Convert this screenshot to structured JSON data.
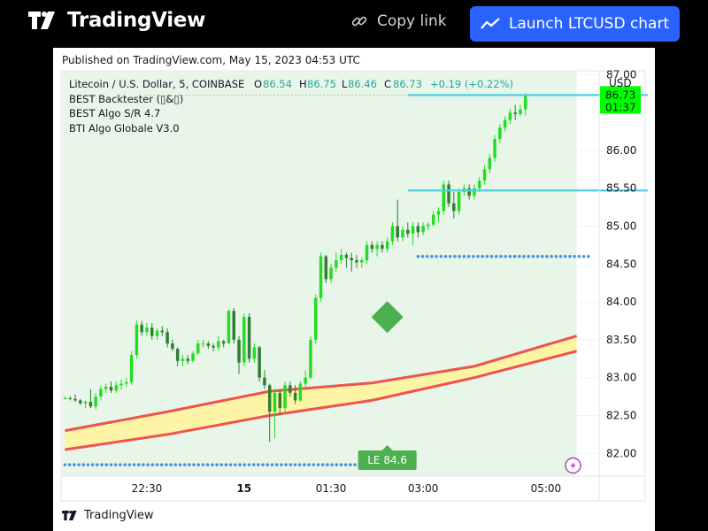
{
  "header": {
    "logo_text": "TradingView",
    "copy_link_label": "Copy link",
    "launch_label": "Launch LTCUSD chart",
    "icons": {
      "logo": "tradingview-logo-icon",
      "copy": "link-icon",
      "launch": "chart-line-icon"
    }
  },
  "published": "Published on TradingView.com, May 15, 2023 04:53 UTC",
  "legend": {
    "symbol": "Litecoin / U.S. Dollar, 5, COINBASE",
    "o_label": "O",
    "o_value": "86.54",
    "h_label": "H",
    "h_value": "86.75",
    "l_label": "L",
    "l_value": "86.46",
    "c_label": "C",
    "c_value": "86.73",
    "change": "+0.19 (+0.22%)",
    "indicators": [
      "BEST Backtester (▯&▯)",
      "BEST Algo S/R 4.7",
      "BTI Algo Globale V3.0"
    ]
  },
  "footer_logo_text": "TradingView",
  "chart_data": {
    "type": "candlestick",
    "symbol": "LTCUSD",
    "exchange": "COINBASE",
    "interval": "5",
    "currency_label": "USD",
    "ylim": [
      81.7,
      87.05
    ],
    "y_ticks": [
      "87.00",
      "86.00",
      "85.50",
      "85.00",
      "84.50",
      "84.00",
      "83.50",
      "83.00",
      "82.50",
      "82.00"
    ],
    "x_ticks": [
      {
        "label": "22:30",
        "bold": false,
        "index": 16
      },
      {
        "label": "15",
        "bold": true,
        "index": 35
      },
      {
        "label": "01:30",
        "bold": false,
        "index": 52
      },
      {
        "label": "03:00",
        "bold": false,
        "index": 70
      },
      {
        "label": "05:00",
        "bold": false,
        "index": 94
      }
    ],
    "last_price": "86.73",
    "countdown": "01:37",
    "bar_count_capacity": 104,
    "colors": {
      "up": "#22dd22",
      "down": "#2e7d32",
      "support": "#4dd0e1",
      "band": "#ef5350",
      "band_fill": "#fff59d",
      "dots": "#4a90d9",
      "bg_zone": "#e8f5e9",
      "signal": "#4caf50",
      "price_tag": "#00ff00"
    },
    "candles": [
      [
        82.73,
        82.75,
        82.71,
        82.73
      ],
      [
        82.73,
        82.75,
        82.7,
        82.72
      ],
      [
        82.72,
        82.78,
        82.68,
        82.7
      ],
      [
        82.7,
        82.72,
        82.64,
        82.66
      ],
      [
        82.66,
        82.7,
        82.6,
        82.68
      ],
      [
        82.68,
        82.85,
        82.6,
        82.62
      ],
      [
        82.62,
        82.8,
        82.58,
        82.75
      ],
      [
        82.75,
        82.9,
        82.7,
        82.85
      ],
      [
        82.85,
        82.92,
        82.8,
        82.88
      ],
      [
        82.88,
        82.95,
        82.8,
        82.83
      ],
      [
        82.83,
        82.95,
        82.8,
        82.9
      ],
      [
        82.9,
        82.98,
        82.84,
        82.92
      ],
      [
        82.92,
        83.0,
        82.88,
        82.94
      ],
      [
        82.94,
        83.35,
        82.9,
        83.3
      ],
      [
        83.3,
        83.75,
        83.25,
        83.7
      ],
      [
        83.7,
        83.75,
        83.55,
        83.6
      ],
      [
        83.6,
        83.72,
        83.55,
        83.66
      ],
      [
        83.66,
        83.72,
        83.5,
        83.55
      ],
      [
        83.55,
        83.65,
        83.5,
        83.62
      ],
      [
        83.62,
        83.68,
        83.55,
        83.6
      ],
      [
        83.6,
        83.65,
        83.4,
        83.45
      ],
      [
        83.45,
        83.5,
        83.35,
        83.38
      ],
      [
        83.38,
        83.4,
        83.15,
        83.22
      ],
      [
        83.22,
        83.3,
        83.15,
        83.25
      ],
      [
        83.25,
        83.3,
        83.18,
        83.22
      ],
      [
        83.22,
        83.35,
        83.2,
        83.32
      ],
      [
        83.32,
        83.5,
        83.3,
        83.45
      ],
      [
        83.45,
        83.5,
        83.4,
        83.45
      ],
      [
        83.45,
        83.48,
        83.38,
        83.42
      ],
      [
        83.42,
        83.45,
        83.35,
        83.4
      ],
      [
        83.4,
        83.55,
        83.35,
        83.48
      ],
      [
        83.48,
        83.5,
        83.4,
        83.45
      ],
      [
        83.45,
        83.9,
        83.45,
        83.88
      ],
      [
        83.88,
        83.92,
        83.45,
        83.5
      ],
      [
        83.5,
        83.55,
        83.05,
        83.2
      ],
      [
        83.2,
        83.85,
        83.15,
        83.8
      ],
      [
        83.8,
        83.85,
        83.2,
        83.25
      ],
      [
        83.25,
        83.45,
        83.2,
        83.4
      ],
      [
        83.4,
        83.42,
        82.95,
        83.0
      ],
      [
        83.0,
        83.1,
        82.85,
        82.9
      ],
      [
        82.9,
        82.92,
        82.15,
        82.55
      ],
      [
        82.55,
        82.85,
        82.2,
        82.8
      ],
      [
        82.8,
        82.85,
        82.5,
        82.6
      ],
      [
        82.6,
        82.95,
        82.55,
        82.9
      ],
      [
        82.9,
        82.95,
        82.75,
        82.8
      ],
      [
        82.8,
        82.9,
        82.65,
        82.7
      ],
      [
        82.7,
        82.95,
        82.68,
        82.92
      ],
      [
        82.92,
        83.1,
        82.88,
        83.0
      ],
      [
        83.0,
        83.55,
        82.98,
        83.5
      ],
      [
        83.5,
        84.1,
        83.45,
        84.05
      ],
      [
        84.05,
        84.65,
        84.0,
        84.6
      ],
      [
        84.6,
        84.62,
        84.25,
        84.3
      ],
      [
        84.3,
        84.5,
        84.25,
        84.45
      ],
      [
        84.45,
        84.65,
        84.4,
        84.55
      ],
      [
        84.55,
        84.7,
        84.5,
        84.62
      ],
      [
        84.62,
        84.65,
        84.45,
        84.58
      ],
      [
        84.58,
        84.65,
        84.4,
        84.55
      ],
      [
        84.55,
        84.62,
        84.45,
        84.52
      ],
      [
        84.52,
        84.58,
        84.45,
        84.55
      ],
      [
        84.55,
        84.8,
        84.5,
        84.75
      ],
      [
        84.75,
        84.8,
        84.65,
        84.7
      ],
      [
        84.7,
        84.8,
        84.6,
        84.75
      ],
      [
        84.75,
        84.8,
        84.65,
        84.7
      ],
      [
        84.7,
        84.85,
        84.65,
        84.8
      ],
      [
        84.8,
        85.05,
        84.75,
        85.0
      ],
      [
        85.0,
        85.35,
        84.8,
        84.85
      ],
      [
        84.85,
        85.0,
        84.8,
        84.95
      ],
      [
        84.95,
        85.05,
        84.85,
        84.9
      ],
      [
        84.9,
        85.05,
        84.75,
        85.0
      ],
      [
        85.0,
        85.05,
        84.85,
        84.92
      ],
      [
        84.92,
        85.05,
        84.88,
        85.0
      ],
      [
        85.0,
        85.05,
        84.95,
        85.02
      ],
      [
        85.02,
        85.2,
        85.0,
        85.15
      ],
      [
        85.15,
        85.25,
        85.05,
        85.2
      ],
      [
        85.2,
        85.6,
        85.15,
        85.55
      ],
      [
        85.55,
        85.6,
        85.25,
        85.3
      ],
      [
        85.3,
        85.45,
        85.1,
        85.2
      ],
      [
        85.2,
        85.5,
        85.15,
        85.45
      ],
      [
        85.45,
        85.55,
        85.4,
        85.5
      ],
      [
        85.5,
        85.55,
        85.35,
        85.4
      ],
      [
        85.4,
        85.55,
        85.35,
        85.5
      ],
      [
        85.5,
        85.65,
        85.45,
        85.6
      ],
      [
        85.6,
        85.8,
        85.55,
        85.75
      ],
      [
        85.75,
        85.95,
        85.7,
        85.9
      ],
      [
        85.9,
        86.2,
        85.85,
        86.15
      ],
      [
        86.15,
        86.35,
        86.1,
        86.3
      ],
      [
        86.3,
        86.45,
        86.25,
        86.4
      ],
      [
        86.4,
        86.55,
        86.35,
        86.5
      ],
      [
        86.5,
        86.6,
        86.4,
        86.48
      ],
      [
        86.48,
        86.6,
        86.45,
        86.54
      ],
      [
        86.54,
        86.75,
        86.46,
        86.73
      ]
    ],
    "support_lines": [
      {
        "price": 86.73,
        "from_index": 67,
        "to_index": 103
      },
      {
        "price": 85.47,
        "from_index": 67,
        "to_index": 103
      }
    ],
    "dotted_levels": [
      {
        "price": 81.85,
        "from_index": 0,
        "to_index": 65
      },
      {
        "price": 84.6,
        "from_index": 69,
        "to_index": 103
      }
    ],
    "band_upper": [
      [
        0,
        82.3
      ],
      [
        20,
        82.55
      ],
      [
        40,
        82.82
      ],
      [
        60,
        82.93
      ],
      [
        80,
        83.15
      ],
      [
        100,
        83.55
      ]
    ],
    "band_lower": [
      [
        0,
        82.05
      ],
      [
        20,
        82.25
      ],
      [
        40,
        82.5
      ],
      [
        60,
        82.7
      ],
      [
        80,
        83.0
      ],
      [
        100,
        83.35
      ]
    ],
    "signal_diamond": {
      "index": 63,
      "price": 83.8
    },
    "entry_label": {
      "text": "LE 84.6",
      "index": 63
    },
    "shaded_zone": {
      "from_index": 0,
      "to_index": 100
    }
  }
}
